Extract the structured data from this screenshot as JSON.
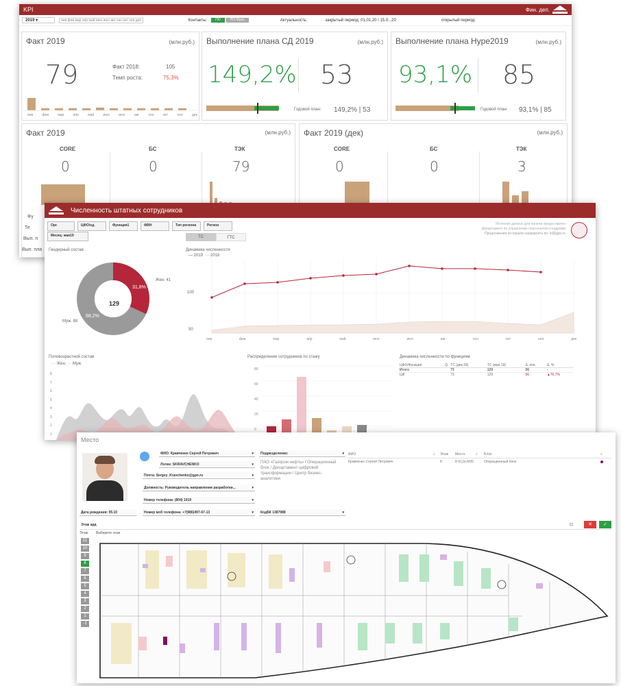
{
  "kpi": {
    "title": "KPI",
    "header_right": "Фин. деп.",
    "year": "2019",
    "months_bar": "янв фев мар апр май июн июл авг сен окт ноя дек",
    "contour_label": "Контакты:",
    "toggle_a": "ПО",
    "toggle_b": "ПО Муль",
    "actuality_label": "Актуальность:",
    "closed_period": "закрытый период: 01.01.20 / 15.0...20",
    "open_period": "открытый период:",
    "fact": {
      "title": "Факт 2019",
      "unit": "(млн.руб.)",
      "value": "79",
      "prev_label": "Факт 2018:",
      "prev_value": "105",
      "growth_label": "Темп роста:",
      "growth_value": "75,3%",
      "months": [
        "янв",
        "фев",
        "мар",
        "апр",
        "май",
        "июн",
        "июл",
        "авг",
        "сен",
        "окт",
        "ноя",
        "дек"
      ]
    },
    "plan_sd": {
      "title": "Выполнение плана СД 2019",
      "unit": "(млн.руб.)",
      "percent": "149,2%",
      "value": "53",
      "yearly_label": "Годовой план:",
      "yearly_value": "149,2% | 53"
    },
    "plan_hype": {
      "title": "Выполнение плана Hype2019",
      "unit": "(млн.руб.)",
      "percent": "93,1%",
      "value": "85",
      "yearly_label": "Годовой план:",
      "yearly_value": "93,1% | 85"
    },
    "fact_seg": {
      "title": "Факт 2019",
      "unit": "(млн.руб.)",
      "segments": [
        {
          "label": "CORE",
          "value": "0"
        },
        {
          "label": "БС",
          "value": "0"
        },
        {
          "label": "ТЭК",
          "value": "79"
        }
      ]
    },
    "fact_dec": {
      "title": "Факт 2019 (дек)",
      "unit": "(млн.руб.)",
      "segments": [
        {
          "label": "CORE",
          "value": "0"
        },
        {
          "label": "БС",
          "value": "0"
        },
        {
          "label": "ТЭК",
          "value": "3"
        }
      ]
    },
    "left_cut": [
      "Фу",
      "Те",
      "Вып. п",
      "Вып. пла"
    ]
  },
  "staff": {
    "title": "Численность штатных сотрудников",
    "filters": [
      "Орг.",
      "ЦФО/ед.",
      "Функция1",
      "ФВН",
      "Тип региона",
      "Регион"
    ],
    "month_filter": "Месяц: мая19",
    "toggle_a": "ТС",
    "toggle_b": "ГТС",
    "source_lines": [
      "Источник данных для панели предоставлен",
      "Департамент по управлению персоналом и кадрами",
      "Предложения по панели направлять по: bi@gpn.ru"
    ],
    "gender": {
      "title": "Гендерный состав",
      "total": "129",
      "female_label": "Жен. 41",
      "female_pct": "31,8%",
      "male_label": "Муж. 88",
      "male_pct": "68,2%"
    },
    "dynamics": {
      "title": "Динамика численности",
      "legend": [
        "2019",
        "2018"
      ],
      "months": [
        "янв",
        "фев",
        "мар",
        "апр",
        "май",
        "июн",
        "июл",
        "авг",
        "сен",
        "окт",
        "ноя",
        "дек"
      ],
      "ticks": [
        "100",
        "50"
      ]
    },
    "age": {
      "title": "Половозрастной состав",
      "legend": [
        "Жен.",
        "Муж."
      ],
      "ticks": [
        "8",
        "7",
        "6",
        "5",
        "4",
        "3",
        "2",
        "1",
        "0"
      ]
    },
    "tenure": {
      "title": "Распределение сотрудников по стажу",
      "ticks": [
        "80",
        "60",
        "40",
        "20",
        "0"
      ]
    },
    "func": {
      "title": "Динамика численности по функциям",
      "headers": [
        "ЦФО/Функция",
        "Q",
        "ТС (дек.18)",
        "ТС (мая.19)",
        "Δ, кол.",
        "Δ, %"
      ],
      "rows": [
        [
          "Итого",
          "",
          "73",
          "129",
          "56",
          "-"
        ],
        [
          "ЦФ",
          "",
          "73",
          "129",
          "56",
          "▲76,7%"
        ]
      ]
    }
  },
  "place": {
    "title": "Место",
    "fio": "ФИО: Кравченко Сергей Петрович",
    "login": "Логин: SKRAVCHENKO",
    "email": "Почта: Sergey_Kravchenko@gpn.ru",
    "position": "Должность: Руководитель направления разработки...",
    "phone": "Номер телефона: (804) 1019",
    "mobile": "Номер моб телефона: +7(986)497-67-13",
    "birthday": "Дата рождения: 05.10",
    "department_label": "Подразделение:",
    "department": "ПАО «Газпром нефть» / Операционный блок / Департамент цифровой трансформации / Центр бизнес-аналитики",
    "code": "КодБК 1387988",
    "table_headers": [
      "ФИО",
      "Этаж",
      "Место",
      "Блок"
    ],
    "table_row": [
      "Кравченко Сергей Петрович",
      "8",
      "8-К12а-М36",
      "Операционный блок"
    ],
    "floor_select_label": "Выберите этаж",
    "floor_label": "Этаж:",
    "floors": [
      "11",
      "10",
      "9",
      "8",
      "7",
      "6",
      "5",
      "4",
      "3",
      "2",
      "1",
      "-1"
    ],
    "active_floor": "8",
    "search_placeholder": "Этаж ард",
    "buttons": {
      "cancel": "✕",
      "ok": "✓"
    }
  },
  "colors": {
    "brand": "#9c2b2b",
    "green": "#2e9e48",
    "tan": "#c9a27a",
    "dark_red": "#b5263a",
    "grey": "#999999"
  }
}
